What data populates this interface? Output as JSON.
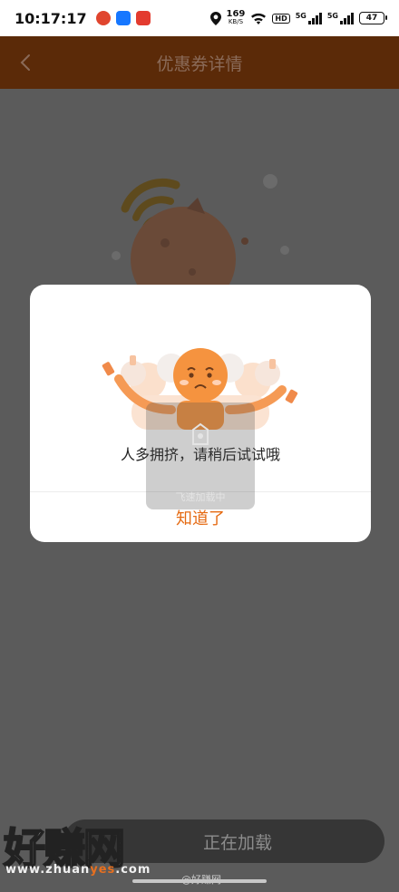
{
  "status_bar": {
    "time": "10:17:17",
    "net_speed": "169",
    "net_unit": "KB/S",
    "hd": "HD",
    "signal1_label": "5G",
    "signal2_label": "5G",
    "battery": "47"
  },
  "header": {
    "title": "优惠券详情",
    "back_icon": "chevron-left-icon"
  },
  "dialog": {
    "message": "人多拥挤，请稍后试试哦",
    "confirm_label": "知道了"
  },
  "toast": {
    "text": "飞速加载中"
  },
  "footer": {
    "loading_text": "正在加载"
  },
  "watermark": {
    "site_name": "好赚网",
    "url_prefix": "www.zhuan",
    "url_highlight": "yes",
    "url_suffix": ".com",
    "weibo": "@好赚网"
  },
  "colors": {
    "header_bg": "#5b2a08",
    "accent": "#e56a12",
    "overlay": "#5b5b5b"
  }
}
